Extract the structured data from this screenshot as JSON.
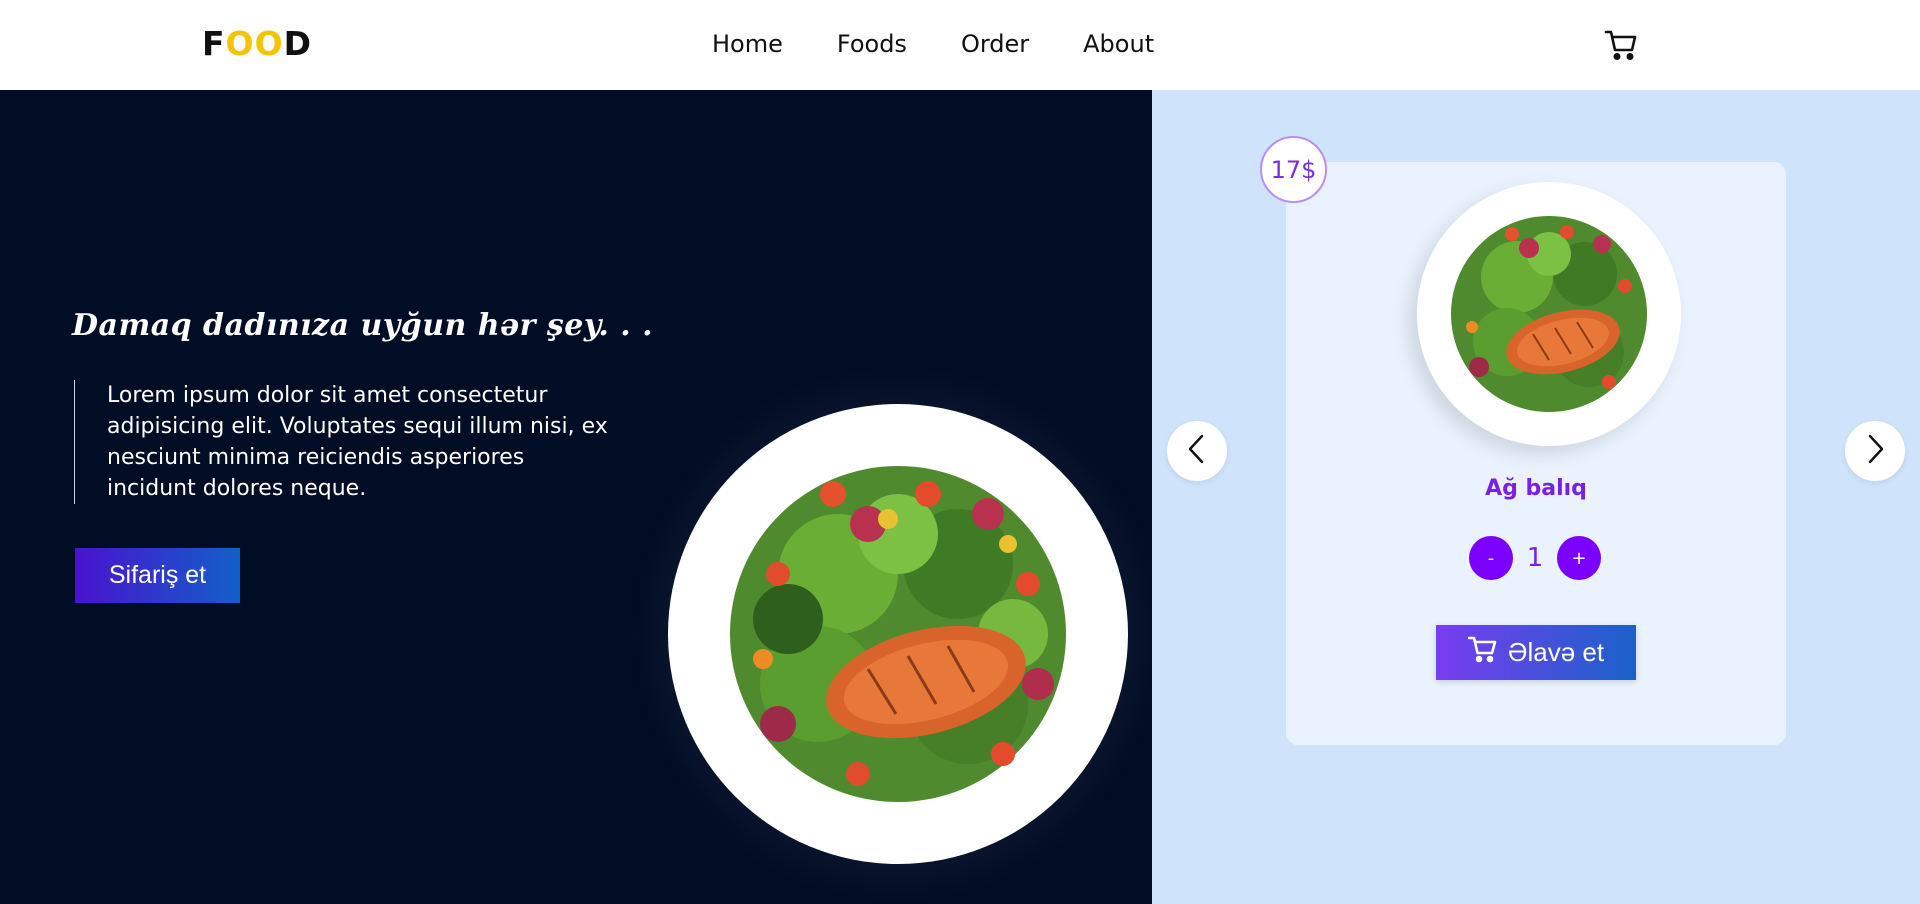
{
  "navbar": {
    "logo": {
      "first": "F",
      "middle": "OO",
      "last": "D"
    },
    "links": [
      "Home",
      "Foods",
      "Order",
      "About"
    ],
    "cart_icon": "cart-icon"
  },
  "hero": {
    "tagline": "Damaq dadınıza uyğun hər şey. . .",
    "description": "Lorem ipsum dolor sit amet consectetur adipisicing elit. Voluptates sequi illum nisi, ex nesciunt minima reiciendis asperiores incidunt dolores neque.",
    "order_button": "Sifariş et",
    "image": "salmon-salad-plate"
  },
  "carousel": {
    "prev_icon": "chevron-left-icon",
    "next_icon": "chevron-right-icon",
    "card": {
      "price": "17$",
      "name": "Ağ balıq",
      "quantity": "1",
      "minus": "-",
      "plus": "+",
      "add_button": "Əlavə et",
      "add_icon": "cart-icon"
    }
  },
  "colors": {
    "hero_bg": "#010c25",
    "panel_bg": "#cfe3fb",
    "card_bg": "#e9f2fd",
    "accent_purple": "#7b00ff",
    "logo_yellow": "#f5c400"
  }
}
